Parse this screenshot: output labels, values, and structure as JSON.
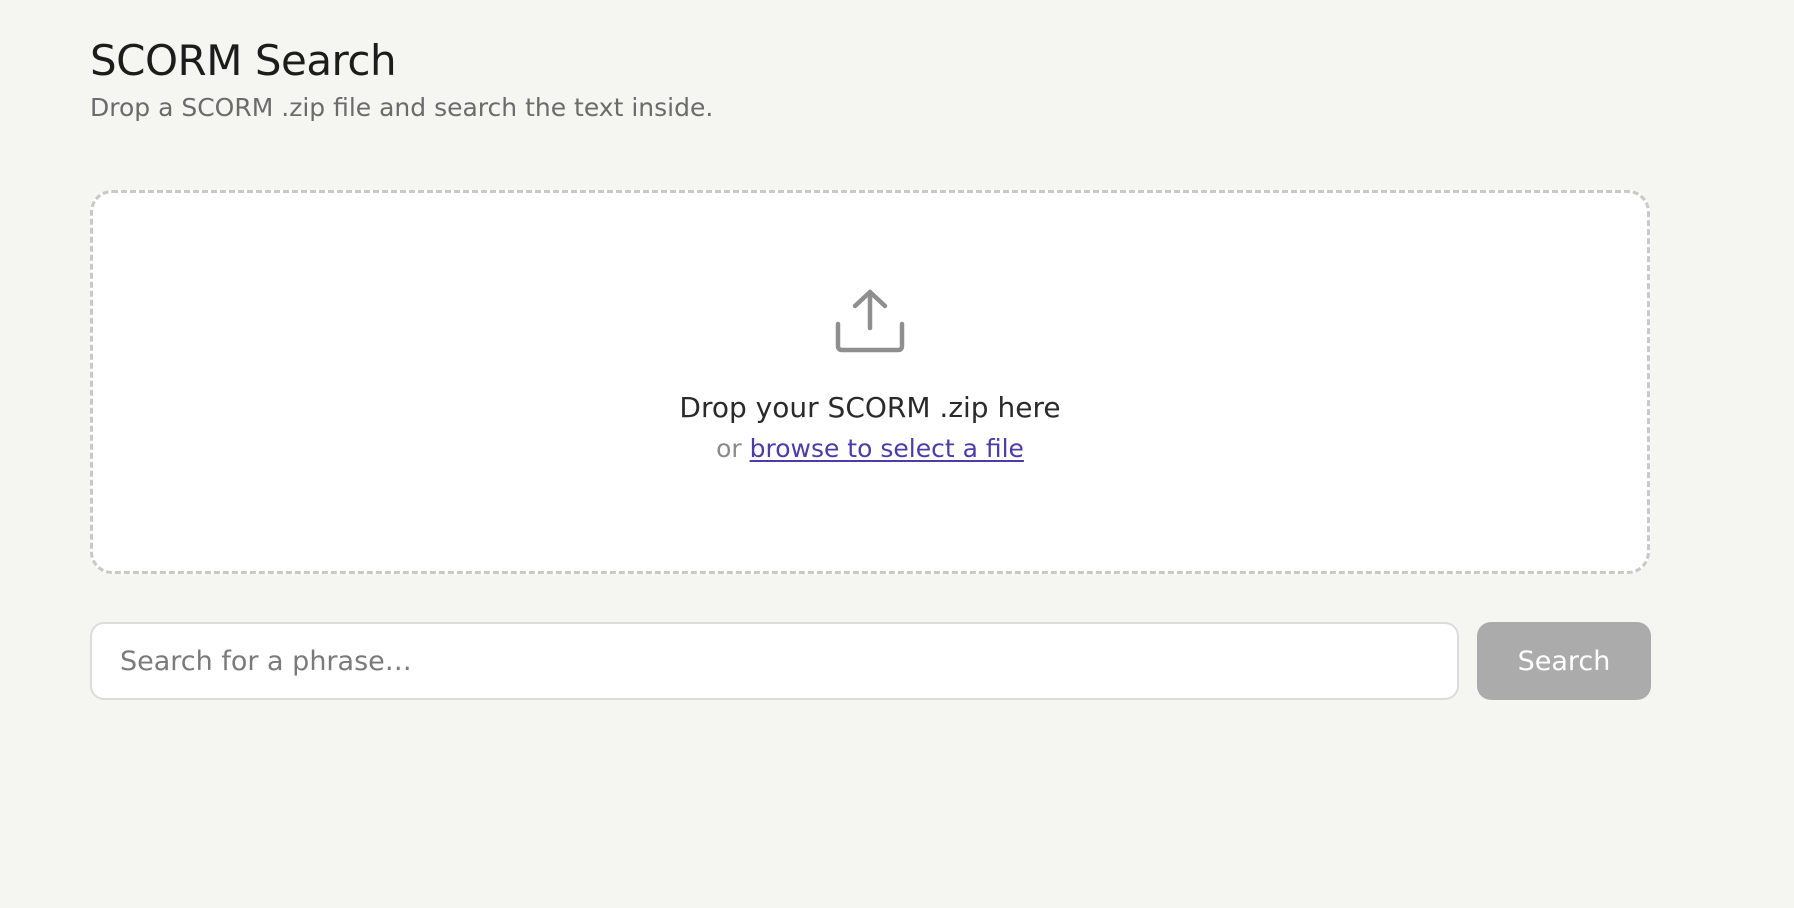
{
  "header": {
    "title": "SCORM Search",
    "subtitle": "Drop a SCORM .zip file and search the text inside."
  },
  "dropzone": {
    "icon": "upload-icon",
    "title": "Drop your SCORM .zip here",
    "alt_prefix": "or",
    "browse_link": "browse to select a file"
  },
  "search": {
    "placeholder": "Search for a phrase…",
    "value": "",
    "button_label": "Search"
  },
  "colors": {
    "background": "#f5f5f1",
    "link": "#4b3ca8",
    "button_disabled": "#ababab"
  }
}
